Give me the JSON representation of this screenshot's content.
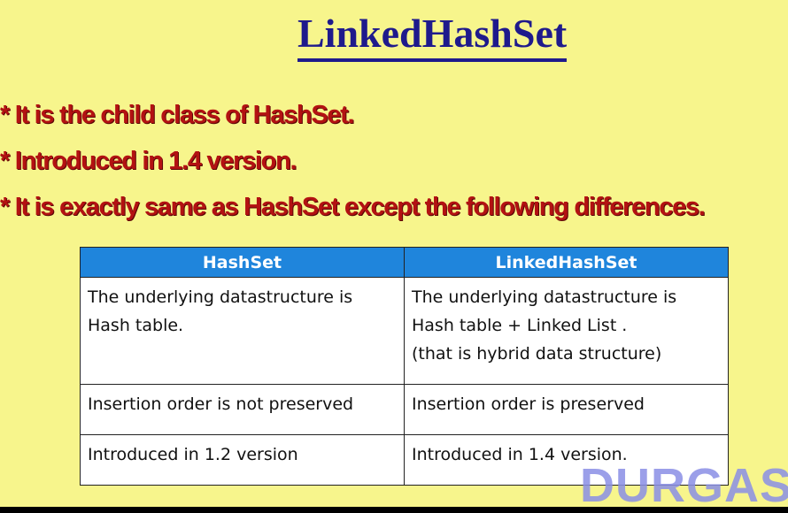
{
  "title": "LinkedHashSet",
  "bullets": [
    "* It is the child class of HashSet.",
    "* Introduced in 1.4 version.",
    "* It is exactly same as HashSet except the following differences."
  ],
  "table": {
    "headers": [
      "HashSet",
      "LinkedHashSet"
    ],
    "rows": [
      {
        "hashset": [
          "The underlying datastructure is",
          "Hash table."
        ],
        "linked": [
          "The underlying datastructure is",
          "Hash table + Linked List .",
          "(that is hybrid data structure)"
        ]
      },
      {
        "hashset": [
          "Insertion order is not preserved"
        ],
        "linked": [
          "Insertion order is preserved"
        ]
      },
      {
        "hashset": [
          "Introduced in 1.2 version"
        ],
        "linked": [
          "Introduced in 1.4 version."
        ]
      }
    ]
  },
  "watermark": "DURGAS",
  "colors": {
    "background": "#f7f58c",
    "title": "#1f1a8c",
    "bullets": "#b31212",
    "table_header": "#1f85dc",
    "watermark": "#8a8fe6"
  }
}
